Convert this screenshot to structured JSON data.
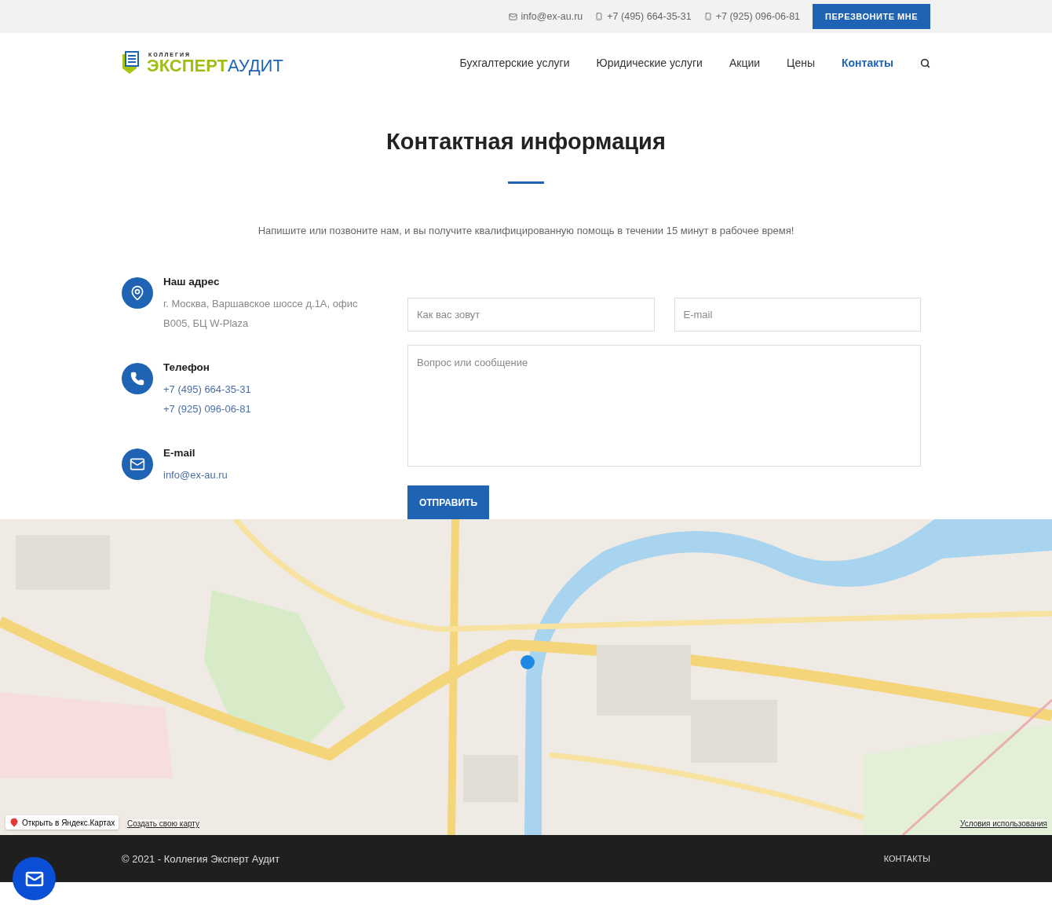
{
  "top_bar": {
    "contacts": [
      {
        "kind": "email",
        "text": "info@ex-au.ru"
      },
      {
        "kind": "phone",
        "text": "+7 (495) 664-35-31"
      },
      {
        "kind": "phone",
        "text": "+7 (925) 096-06-81"
      }
    ],
    "callback_button": "ПЕРЕЗВОНИТЕ МНЕ"
  },
  "header": {
    "logo": {
      "small": "КОЛЛЕГИЯ",
      "part1": "ЭКСПЕРТ",
      "part2": "АУДИТ"
    },
    "nav": [
      {
        "label": "Бухгалтерские услуги",
        "selected": false
      },
      {
        "label": "Юридические услуги",
        "selected": false
      },
      {
        "label": "Акции",
        "selected": false
      },
      {
        "label": "Цены",
        "selected": false
      },
      {
        "label": "Контакты",
        "selected": true
      }
    ]
  },
  "title": "Контактная информация",
  "subtitle": "Напишите или позвоните нам, и вы получите квалифицированную помощь в течении 15 минут в рабочее время!",
  "contacts": [
    {
      "kind": "address",
      "title": "Наш адрес",
      "lines": [
        "г. Москва, Варшавское шоссе д.1А, офис В005, БЦ W-Plaza"
      ]
    },
    {
      "kind": "phone",
      "title": "Телефон",
      "lines": [
        "+7 (495) 664-35-31",
        "+7 (925) 096-06-81"
      ]
    },
    {
      "kind": "email",
      "title": "E-mail",
      "lines": [
        "info@ex-au.ru"
      ]
    }
  ],
  "form": {
    "name": {
      "placeholder": "Как вас зовут"
    },
    "email": {
      "placeholder": "E-mail"
    },
    "message": {
      "placeholder": "Вопрос или сообщение"
    },
    "submit": "ОТПРАВИТЬ"
  },
  "map": {
    "kind": "picture",
    "open_button": "Открыть в Яндекс.Картах",
    "create_link": "Создать свою карту",
    "terms_link": "Условия использования"
  },
  "footer": {
    "copyright": "© 2021 - Коллегия Эксперт Аудит",
    "link": "КОНТАКТЫ"
  }
}
